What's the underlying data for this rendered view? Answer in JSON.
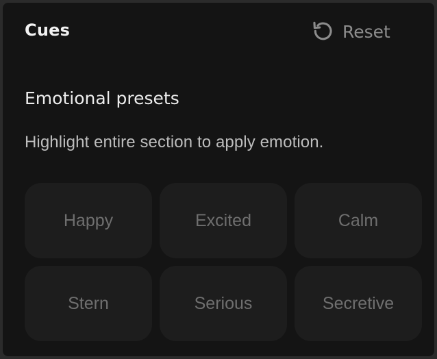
{
  "header": {
    "title": "Cues",
    "reset_label": "Reset",
    "reset_icon": "rotate-ccw-icon"
  },
  "section": {
    "title": "Emotional presets",
    "description": "Highlight entire section to apply emotion."
  },
  "presets": [
    {
      "label": "Happy"
    },
    {
      "label": "Excited"
    },
    {
      "label": "Calm"
    },
    {
      "label": "Stern"
    },
    {
      "label": "Serious"
    },
    {
      "label": "Secretive"
    }
  ],
  "colors": {
    "background": "#141414",
    "preset_tile": "#1d1d1d",
    "preset_text": "#6f6f6f",
    "muted_text": "#8c8c8c"
  }
}
